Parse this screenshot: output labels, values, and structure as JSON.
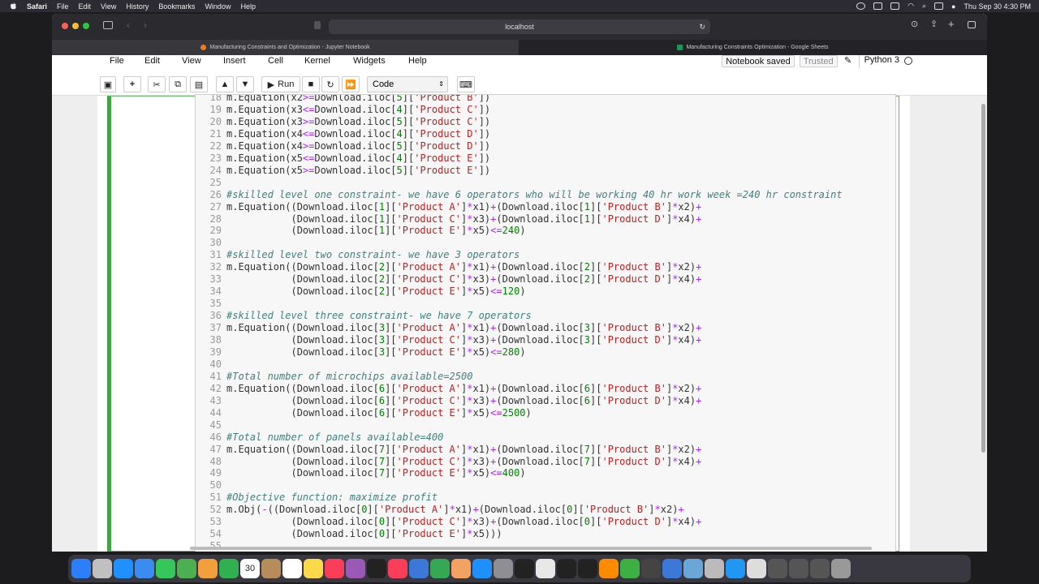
{
  "menubar": {
    "app": "Safari",
    "items": [
      "File",
      "Edit",
      "View",
      "History",
      "Bookmarks",
      "Window",
      "Help"
    ],
    "clock": "Thu Sep 30  4:30 PM"
  },
  "browser": {
    "url": "localhost",
    "tabs": [
      {
        "title": "Manufacturing Constraints and Optimization - Jupyter Notebook",
        "icon_color": "#f37626"
      },
      {
        "title": "Manufacturing Constraints Optimization - Google Sheets",
        "icon_color": "#0f9d58"
      }
    ]
  },
  "jupyter": {
    "menu": [
      "File",
      "Edit",
      "View",
      "Insert",
      "Cell",
      "Kernel",
      "Widgets",
      "Help"
    ],
    "status_saved": "Notebook saved",
    "status_trusted": "Trusted",
    "kernel": "Python 3",
    "run_label": "Run",
    "cell_type": "Code"
  },
  "code_lines": [
    {
      "no": "18",
      "html": "m.Equation(x2<span class=\"o\">&gt;=</span>Download.iloc[<span class=\"n\">5</span>][<span class=\"s\">'Product B'</span>])"
    },
    {
      "no": "19",
      "html": "m.Equation(x3<span class=\"o\">&lt;=</span>Download.iloc[<span class=\"n\">4</span>][<span class=\"s\">'Product C'</span>])"
    },
    {
      "no": "20",
      "html": "m.Equation(x3<span class=\"o\">&gt;=</span>Download.iloc[<span class=\"n\">5</span>][<span class=\"s\">'Product C'</span>])"
    },
    {
      "no": "21",
      "html": "m.Equation(x4<span class=\"o\">&lt;=</span>Download.iloc[<span class=\"n\">4</span>][<span class=\"s\">'Product D'</span>])"
    },
    {
      "no": "22",
      "html": "m.Equation(x4<span class=\"o\">&gt;=</span>Download.iloc[<span class=\"n\">5</span>][<span class=\"s\">'Product D'</span>])"
    },
    {
      "no": "23",
      "html": "m.Equation(x5<span class=\"o\">&lt;=</span>Download.iloc[<span class=\"n\">4</span>][<span class=\"s\">'Product E'</span>])"
    },
    {
      "no": "24",
      "html": "m.Equation(x5<span class=\"o\">&gt;=</span>Download.iloc[<span class=\"n\">5</span>][<span class=\"s\">'Product E'</span>])"
    },
    {
      "no": "25",
      "html": ""
    },
    {
      "no": "26",
      "html": "<span class=\"c\">#skilled level one constraint- we have 6 operators who will be working 40 hr work week =240 hr constraint</span>"
    },
    {
      "no": "27",
      "html": "m.Equation((Download.iloc[<span class=\"n\">1</span>][<span class=\"s\">'Product A'</span>]<span class=\"o\">*</span>x1)<span class=\"o\">+</span>(Download.iloc[<span class=\"n\">1</span>][<span class=\"s\">'Product B'</span>]<span class=\"o\">*</span>x2)<span class=\"o\">+</span>"
    },
    {
      "no": "28",
      "html": "           (Download.iloc[<span class=\"n\">1</span>][<span class=\"s\">'Product C'</span>]<span class=\"o\">*</span>x3)<span class=\"o\">+</span>(Download.iloc[<span class=\"n\">1</span>][<span class=\"s\">'Product D'</span>]<span class=\"o\">*</span>x4)<span class=\"o\">+</span>"
    },
    {
      "no": "29",
      "html": "           (Download.iloc[<span class=\"n\">1</span>][<span class=\"s\">'Product E'</span>]<span class=\"o\">*</span>x5)<span class=\"o\">&lt;=</span><span class=\"n\">240</span>)"
    },
    {
      "no": "30",
      "html": ""
    },
    {
      "no": "31",
      "html": "<span class=\"c\">#skilled level two constraint- we have 3 operators</span>"
    },
    {
      "no": "32",
      "html": "m.Equation((Download.iloc[<span class=\"n\">2</span>][<span class=\"s\">'Product A'</span>]<span class=\"o\">*</span>x1)<span class=\"o\">+</span>(Download.iloc[<span class=\"n\">2</span>][<span class=\"s\">'Product B'</span>]<span class=\"o\">*</span>x2)<span class=\"o\">+</span>"
    },
    {
      "no": "33",
      "html": "           (Download.iloc[<span class=\"n\">2</span>][<span class=\"s\">'Product C'</span>]<span class=\"o\">*</span>x3)<span class=\"o\">+</span>(Download.iloc[<span class=\"n\">2</span>][<span class=\"s\">'Product D'</span>]<span class=\"o\">*</span>x4)<span class=\"o\">+</span>"
    },
    {
      "no": "34",
      "html": "           (Download.iloc[<span class=\"n\">2</span>][<span class=\"s\">'Product E'</span>]<span class=\"o\">*</span>x5)<span class=\"o\">&lt;=</span><span class=\"n\">120</span>)"
    },
    {
      "no": "35",
      "html": ""
    },
    {
      "no": "36",
      "html": "<span class=\"c\">#skilled level three constraint- we have 7 operators</span>"
    },
    {
      "no": "37",
      "html": "m.Equation((Download.iloc[<span class=\"n\">3</span>][<span class=\"s\">'Product A'</span>]<span class=\"o\">*</span>x1)<span class=\"o\">+</span>(Download.iloc[<span class=\"n\">3</span>][<span class=\"s\">'Product B'</span>]<span class=\"o\">*</span>x2)<span class=\"o\">+</span>"
    },
    {
      "no": "38",
      "html": "           (Download.iloc[<span class=\"n\">3</span>][<span class=\"s\">'Product C'</span>]<span class=\"o\">*</span>x3)<span class=\"o\">+</span>(Download.iloc[<span class=\"n\">3</span>][<span class=\"s\">'Product D'</span>]<span class=\"o\">*</span>x4)<span class=\"o\">+</span>"
    },
    {
      "no": "39",
      "html": "           (Download.iloc[<span class=\"n\">3</span>][<span class=\"s\">'Product E'</span>]<span class=\"o\">*</span>x5)<span class=\"o\">&lt;=</span><span class=\"n\">280</span>)"
    },
    {
      "no": "40",
      "html": ""
    },
    {
      "no": "41",
      "html": "<span class=\"c\">#Total number of microchips available=2500</span>"
    },
    {
      "no": "42",
      "html": "m.Equation((Download.iloc[<span class=\"n\">6</span>][<span class=\"s\">'Product A'</span>]<span class=\"o\">*</span>x1)<span class=\"o\">+</span>(Download.iloc[<span class=\"n\">6</span>][<span class=\"s\">'Product B'</span>]<span class=\"o\">*</span>x2)<span class=\"o\">+</span>"
    },
    {
      "no": "43",
      "html": "           (Download.iloc[<span class=\"n\">6</span>][<span class=\"s\">'Product C'</span>]<span class=\"o\">*</span>x3)<span class=\"o\">+</span>(Download.iloc[<span class=\"n\">6</span>][<span class=\"s\">'Product D'</span>]<span class=\"o\">*</span>x4)<span class=\"o\">+</span>"
    },
    {
      "no": "44",
      "html": "           (Download.iloc[<span class=\"n\">6</span>][<span class=\"s\">'Product E'</span>]<span class=\"o\">*</span>x5)<span class=\"o\">&lt;=</span><span class=\"n\">2500</span>)"
    },
    {
      "no": "45",
      "html": ""
    },
    {
      "no": "46",
      "html": "<span class=\"c\">#Total number of panels available=400</span>"
    },
    {
      "no": "47",
      "html": "m.Equation((Download.iloc[<span class=\"n\">7</span>][<span class=\"s\">'Product A'</span>]<span class=\"o\">*</span>x1)<span class=\"o\">+</span>(Download.iloc[<span class=\"n\">7</span>][<span class=\"s\">'Product B'</span>]<span class=\"o\">*</span>x2)<span class=\"o\">+</span>"
    },
    {
      "no": "48",
      "html": "           (Download.iloc[<span class=\"n\">7</span>][<span class=\"s\">'Product C'</span>]<span class=\"o\">*</span>x3)<span class=\"o\">+</span>(Download.iloc[<span class=\"n\">7</span>][<span class=\"s\">'Product D'</span>]<span class=\"o\">*</span>x4)<span class=\"o\">+</span>"
    },
    {
      "no": "49",
      "html": "           (Download.iloc[<span class=\"n\">7</span>][<span class=\"s\">'Product E'</span>]<span class=\"o\">*</span>x5)<span class=\"o\">&lt;=</span><span class=\"n\">400</span>)"
    },
    {
      "no": "50",
      "html": ""
    },
    {
      "no": "51",
      "html": "<span class=\"c\">#Objective function: maximize profit</span>"
    },
    {
      "no": "52",
      "html": "m.Obj(<span class=\"o\">-</span>((Download.iloc[<span class=\"n\">0</span>][<span class=\"s\">'Product A'</span>]<span class=\"o\">*</span>x1)<span class=\"o\">+</span>(Download.iloc[<span class=\"n\">0</span>][<span class=\"s\">'Product B'</span>]<span class=\"o\">*</span>x2)<span class=\"o\">+</span>"
    },
    {
      "no": "53",
      "html": "           (Download.iloc[<span class=\"n\">0</span>][<span class=\"s\">'Product C'</span>]<span class=\"o\">*</span>x3)<span class=\"o\">+</span>(Download.iloc[<span class=\"n\">0</span>][<span class=\"s\">'Product D'</span>]<span class=\"o\">*</span>x4)<span class=\"o\">+</span>"
    },
    {
      "no": "54",
      "html": "           (Download.iloc[<span class=\"n\">0</span>][<span class=\"s\">'Product E'</span>]<span class=\"o\">*</span>x5)))"
    },
    {
      "no": "55",
      "html": ""
    }
  ],
  "dock": {
    "apps": [
      "finder-icon",
      "launchpad-icon",
      "safari-icon",
      "mail-icon",
      "messages-icon",
      "maps-icon",
      "photos-icon",
      "facetime-icon",
      "calendar-icon",
      "contacts-icon",
      "reminders-icon",
      "notes-icon",
      "music-icon",
      "podcasts-icon",
      "tv-icon",
      "news-icon",
      "keynote-icon",
      "numbers-icon",
      "pages-icon",
      "appstore-icon",
      "settings-icon",
      "terminal-icon",
      "chrome-icon",
      "terminal2-icon",
      "github-icon",
      "sublime-icon",
      "activity-icon",
      "bbedit-icon",
      "rstudio-icon",
      "preview-icon",
      "scripteditor-icon",
      "safari2-icon",
      "documents-icon",
      "window1-icon",
      "window2-icon",
      "window3-icon",
      "trash-icon"
    ],
    "calendar_day": "30"
  },
  "colors": {
    "accent": "#42a545",
    "safari_bg": "#2b2a2f"
  }
}
